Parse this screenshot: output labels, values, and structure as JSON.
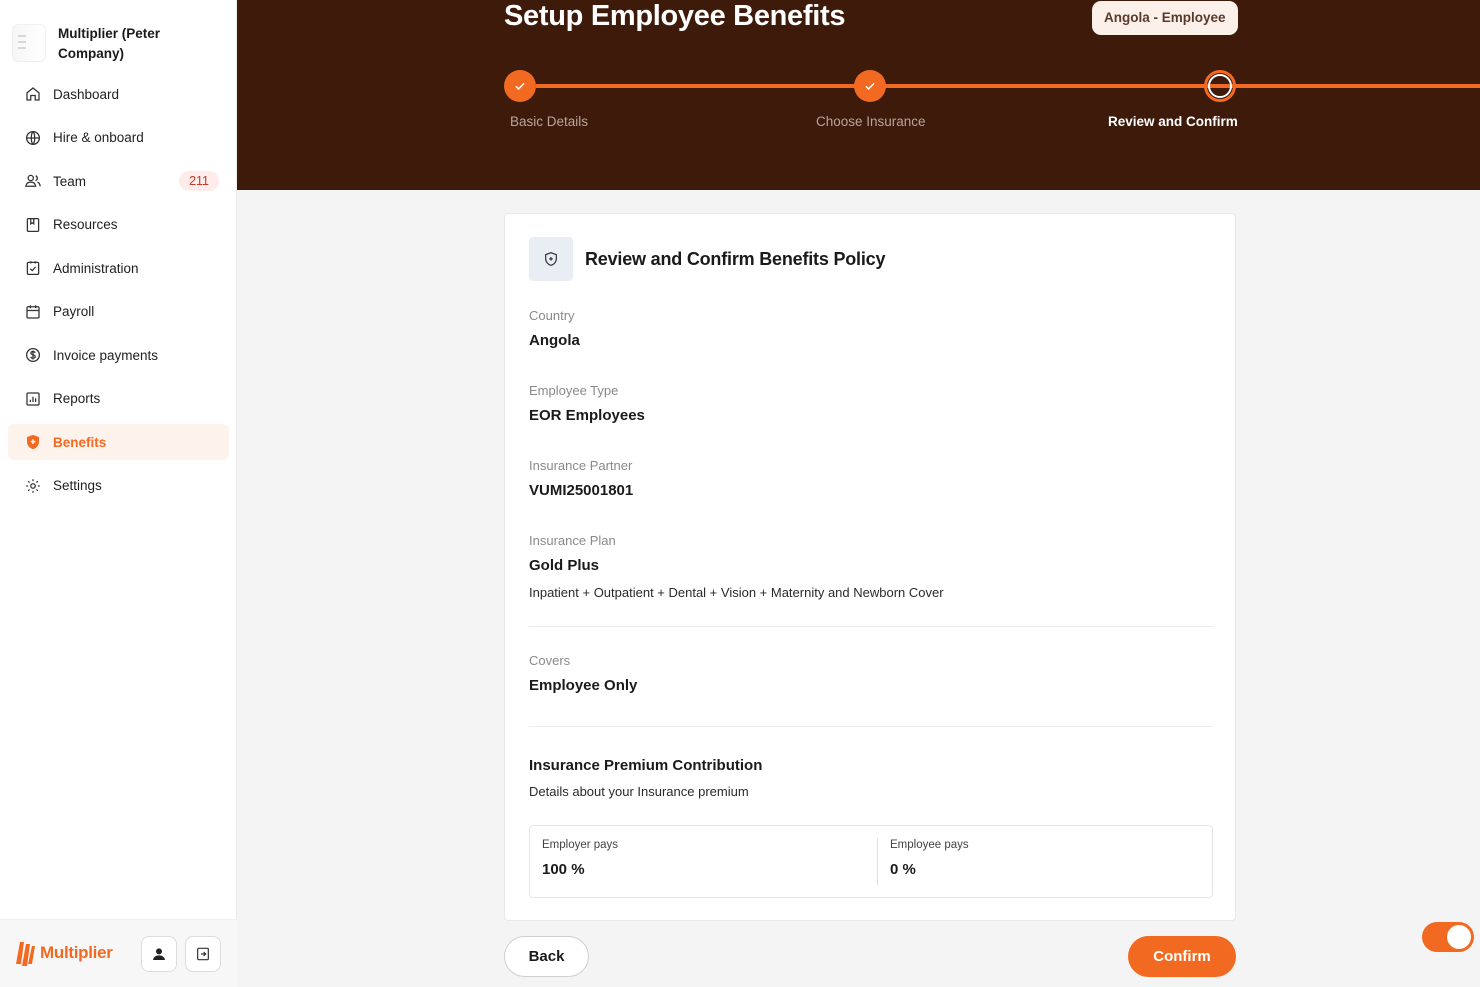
{
  "sidebar": {
    "org_name": "Multiplier (Peter Company)",
    "items": [
      {
        "label": "Dashboard",
        "icon": "home-icon"
      },
      {
        "label": "Hire & onboard",
        "icon": "globe-icon"
      },
      {
        "label": "Team",
        "icon": "users-icon",
        "badge": "211"
      },
      {
        "label": "Resources",
        "icon": "book-icon"
      },
      {
        "label": "Administration",
        "icon": "checklist-icon"
      },
      {
        "label": "Payroll",
        "icon": "calendar-icon"
      },
      {
        "label": "Invoice payments",
        "icon": "dollar-icon"
      },
      {
        "label": "Reports",
        "icon": "chart-icon"
      },
      {
        "label": "Benefits",
        "icon": "shield-icon",
        "active": true
      },
      {
        "label": "Settings",
        "icon": "gear-icon"
      }
    ],
    "brand": "Multiplier"
  },
  "header": {
    "title": "Setup Employee Benefits",
    "pill": "Angola - Employee",
    "steps": [
      "Basic Details",
      "Choose Insurance",
      "Review and Confirm"
    ]
  },
  "card": {
    "title": "Review and Confirm Benefits Policy",
    "country_label": "Country",
    "country": "Angola",
    "employee_type_label": "Employee Type",
    "employee_type": "EOR Employees",
    "partner_label": "Insurance Partner",
    "partner": "VUMI25001801",
    "plan_label": "Insurance Plan",
    "plan": "Gold Plus",
    "plan_desc": "Inpatient + Outpatient + Dental + Vision + Maternity and Newborn Cover",
    "covers_label": "Covers",
    "covers": "Employee Only",
    "premium_title": "Insurance Premium Contribution",
    "premium_desc": "Details about your Insurance premium",
    "employer_label": "Employer pays",
    "employer_value": "100 %",
    "employee_label": "Employee pays",
    "employee_value": "0 %"
  },
  "actions": {
    "back": "Back",
    "confirm": "Confirm"
  },
  "colors": {
    "accent": "#f26a22",
    "header_bg": "#3d1a0a"
  }
}
